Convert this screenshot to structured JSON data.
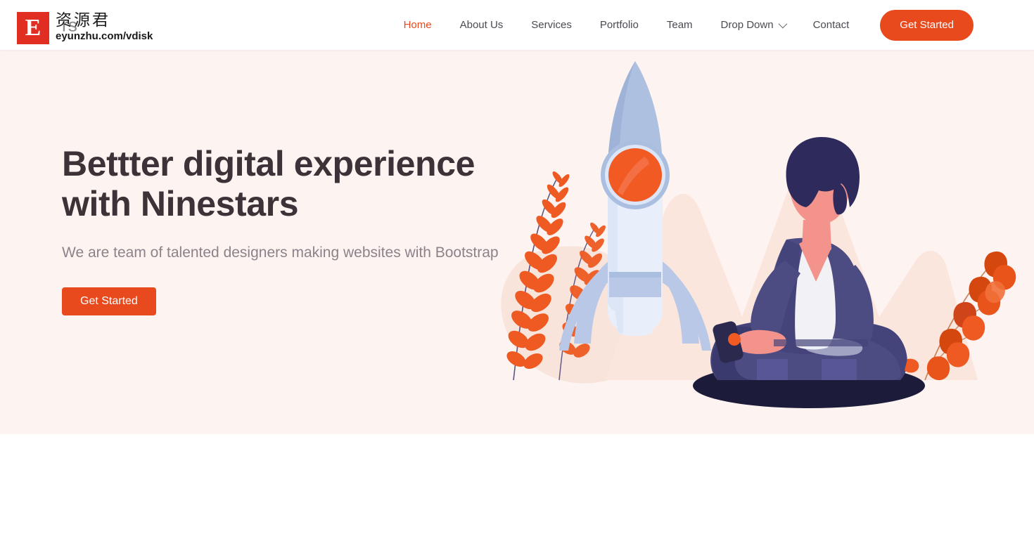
{
  "header": {
    "brand_text": "rs",
    "nav_items": [
      {
        "label": "Home",
        "active": true,
        "has_chevron": false
      },
      {
        "label": "About Us",
        "active": false,
        "has_chevron": false
      },
      {
        "label": "Services",
        "active": false,
        "has_chevron": false
      },
      {
        "label": "Portfolio",
        "active": false,
        "has_chevron": false
      },
      {
        "label": "Team",
        "active": false,
        "has_chevron": false
      },
      {
        "label": "Drop Down",
        "active": false,
        "has_chevron": true
      },
      {
        "label": "Contact",
        "active": false,
        "has_chevron": false
      }
    ],
    "cta_label": "Get Started"
  },
  "hero": {
    "title_line1": "Bettter digital experience",
    "title_line2": "with Ninestars",
    "subtitle": "We are team of talented designers making websites with Bootstrap",
    "cta_label": "Get Started",
    "background_color": "#fdf3f1",
    "title_color": "#3c3238",
    "subtitle_color": "#8d8289"
  },
  "illustration": {
    "name": "rocket-and-seated-person-illustration",
    "elements": [
      "peach-mountain-backdrop",
      "peach-blob",
      "fern-plant-left",
      "rocket",
      "rocket-porthole",
      "rocket-fins",
      "seated-person",
      "mobile-phone",
      "leaf-plant-right",
      "floor-shadow-ellipse"
    ],
    "colors": {
      "mountain": "#fbe6dd",
      "blob": "#f9e3da",
      "rocket_body": "#e8eefa",
      "rocket_nose": "#aec0e0",
      "rocket_fin": "#b9c8e6",
      "porthole": "#f15a22",
      "porthole_ring": "#aabfe0",
      "plant_orange": "#ef5a22",
      "plant_dark_orange": "#cf4418",
      "person_suit": "#4c4c82",
      "person_suit_dark": "#3b3a6e",
      "person_skin": "#f4938c",
      "person_hair": "#2e2b5c",
      "person_shirt": "#f2f2f6",
      "shadow_ellipse": "#1d1b3a",
      "phone": "#2b2a4e"
    }
  },
  "theme": {
    "accent": "#e8491d",
    "nav_text": "#4a4a52",
    "page_background": "#ffffff"
  },
  "watermark": {
    "badge_letter": "E",
    "chinese_text": "资源君",
    "url": "eyunzhu.com/vdisk",
    "badge_color": "#e02f22"
  }
}
